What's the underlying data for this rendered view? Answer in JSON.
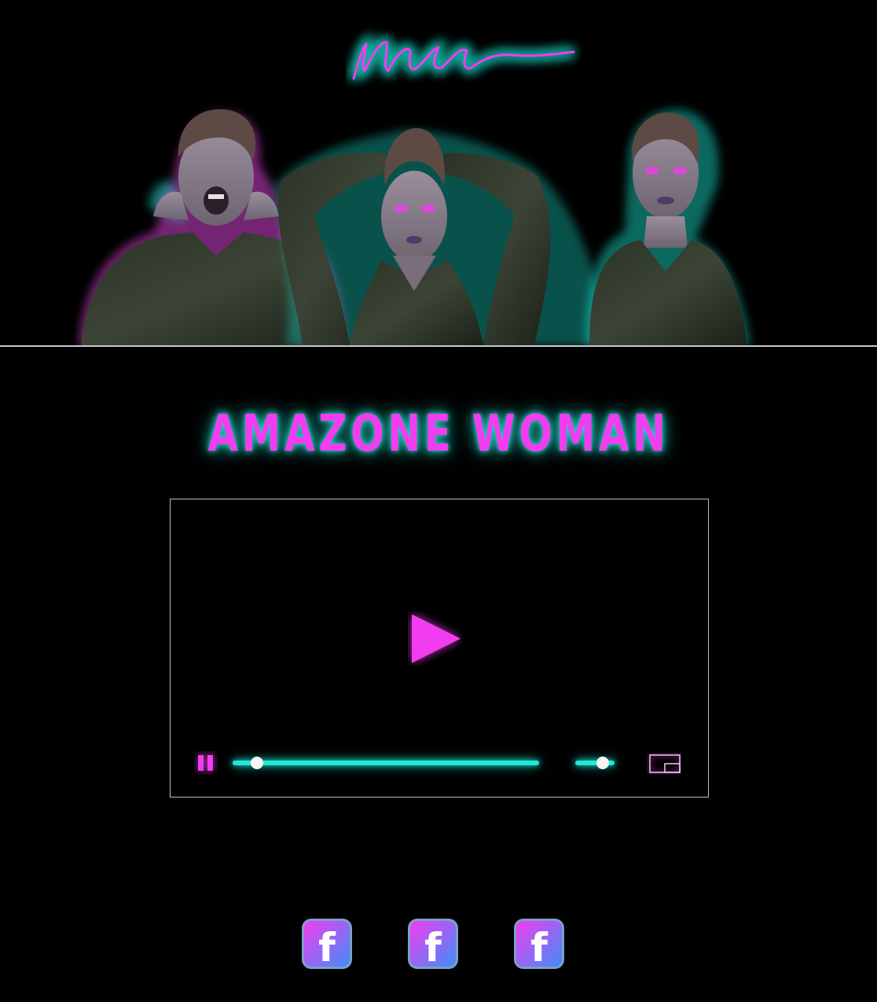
{
  "header": {
    "logo": {
      "icon": "signature-logo",
      "colors": {
        "stroke": "#f23cf0",
        "glow": "#1de9d6"
      }
    },
    "hero": {
      "icon": "artist-photo-triptych"
    }
  },
  "title": {
    "text": "AMAZONE WOMAN"
  },
  "player": {
    "big_play_icon": "play-icon",
    "pause_icon": "pause-icon",
    "pip_icon": "picture-in-picture-icon",
    "progress": 0.08,
    "volume": 0.7
  },
  "social": {
    "links": [
      {
        "icon": "facebook-icon",
        "label": "f"
      },
      {
        "icon": "facebook-icon",
        "label": "f"
      },
      {
        "icon": "facebook-icon",
        "label": "f"
      }
    ]
  },
  "colors": {
    "accent_pink": "#f23cf0",
    "accent_cyan": "#1de9d6",
    "background": "#000000"
  }
}
